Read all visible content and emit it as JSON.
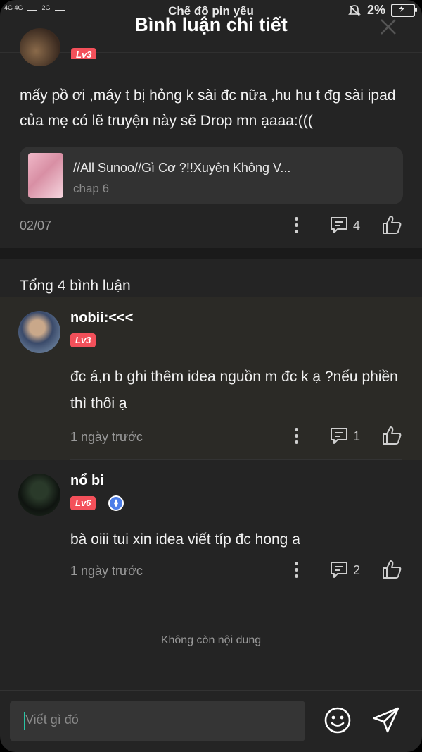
{
  "status_bar": {
    "network_left": "4G 4G",
    "network_right": "2G",
    "center_text": "Chế độ pin yếu",
    "battery_percent": "2%"
  },
  "header": {
    "title": "Bình luận chi tiết"
  },
  "main_comment": {
    "badge": "Lv3",
    "text": "mấy pồ ơi ,máy t bị hỏng k sài đc nữa ,hu hu t đg sài ipad của mẹ có lẽ truyện này sẽ Drop mn ạaaa:(((",
    "story": {
      "title": "//All Sunoo//Gì Cơ ?!!Xuyên Không V...",
      "chapter": "chap 6"
    },
    "date": "02/07",
    "reply_count": "4"
  },
  "comments_header": {
    "total_text": "Tổng 4 bình luận"
  },
  "comments": [
    {
      "name": "nobii:<<<",
      "badge": "Lv3",
      "text": "đc á,n b ghi thêm idea nguồn m đc k ạ ?nếu phiền thì thôi ạ",
      "time": "1 ngày trước",
      "reply_count": "1"
    },
    {
      "name": "nổ bi",
      "badge": "Lv6",
      "text": "bà oiii tui xin idea viết típ đc hong a",
      "time": "1 ngày trước",
      "reply_count": "2"
    }
  ],
  "footer": {
    "no_more_text": "Không còn nội dung",
    "input_placeholder": "Viết gì đó"
  },
  "colors": {
    "background": "#242424",
    "badge": "#f3505a",
    "highlight_row": "#2b2a26",
    "accent_caret": "#29c5a5"
  }
}
